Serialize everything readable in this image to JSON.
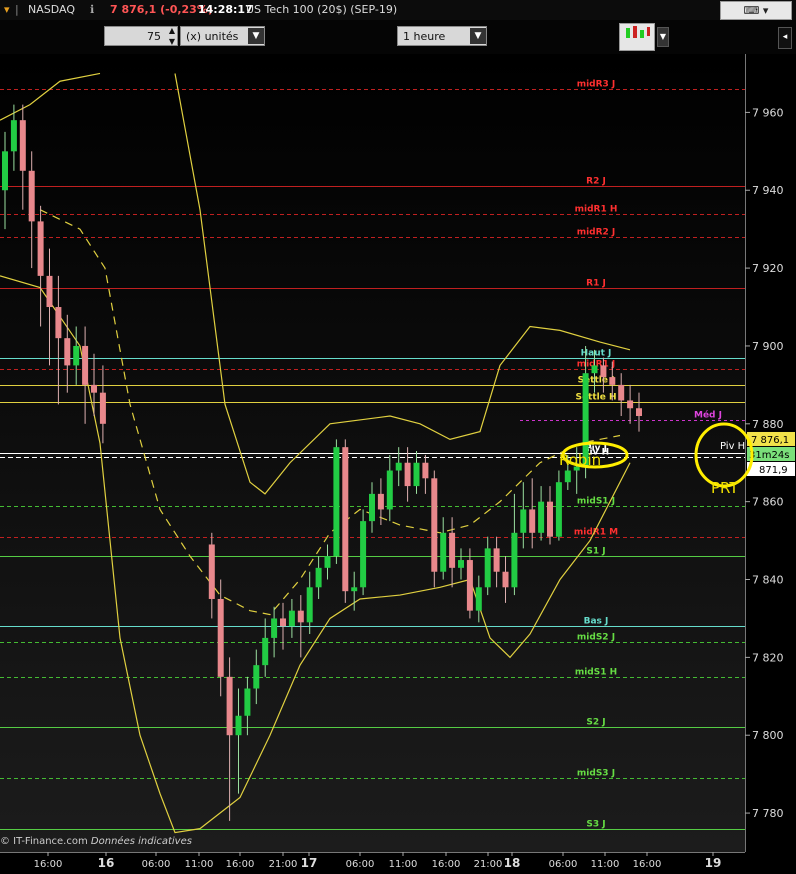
{
  "header": {
    "instrument": "NASDAQ",
    "price_change": "7 876,1 (-0,23%)",
    "time": "14:28:17",
    "description": "US Tech 100 (20$) (SEP-19)"
  },
  "toolbar": {
    "quantity_value": "75",
    "units_label": "(x) unités",
    "timeframe_value": "1 heure"
  },
  "colors": {
    "background": "#000000",
    "bull_candle": "#22cc44",
    "bear_candle": "#e8888c",
    "resistance": "#cc2222",
    "support": "#55cc44",
    "bollinger": "#e0d040",
    "annotation": "#ffee00"
  },
  "annotations": {
    "robin": "Robin",
    "prt": "PRT"
  },
  "footer": {
    "copyright": "© IT-Finance.com",
    "data_note": "Données indicatives"
  },
  "chart_data": {
    "type": "candlestick",
    "ylim": [
      7770,
      7975
    ],
    "y_ticks": [
      "7 960",
      "7 940",
      "7 920",
      "7 900",
      "7 880",
      "7 860",
      "7 840",
      "7 820",
      "7 800",
      "7 780"
    ],
    "x_ticks": [
      "16:00",
      "16",
      "06:00",
      "11:00",
      "16:00",
      "21:00",
      "17",
      "06:00",
      "11:00",
      "16:00",
      "21:00",
      "18",
      "06:00",
      "11:00",
      "16:00",
      "19"
    ],
    "levels": [
      {
        "name": "midR3J",
        "label": "midR3 J",
        "value": 7966,
        "kind": "dashed-red"
      },
      {
        "name": "R2J",
        "label": "R2 J",
        "value": 7941,
        "kind": "solid-red"
      },
      {
        "name": "midR1H",
        "label": "midR1 H",
        "value": 7934,
        "kind": "dashed-red"
      },
      {
        "name": "midR2J",
        "label": "midR2 J",
        "value": 7928,
        "kind": "dashed-red"
      },
      {
        "name": "R1J",
        "label": "R1 J",
        "value": 7915,
        "kind": "solid-red"
      },
      {
        "name": "HautJ",
        "label": "Haut J",
        "value": 7897,
        "kind": "solid-cyan"
      },
      {
        "name": "midR1J",
        "label": "midR1 J",
        "value": 7894,
        "kind": "dashed-red"
      },
      {
        "name": "SettleJ",
        "label": "Settle J",
        "value": 7890,
        "kind": "solid-yellow"
      },
      {
        "name": "SettleH",
        "label": "Settle H",
        "value": 7885.5,
        "kind": "solid-yellow"
      },
      {
        "name": "MedJ",
        "label": "Méd J",
        "value": 7881,
        "kind": "dashed-magenta"
      },
      {
        "name": "PivJ",
        "label": "Piv J",
        "value": 7872.5,
        "kind": "solid-white"
      },
      {
        "name": "PivH",
        "label": "Piv H",
        "value": 7871.5,
        "kind": "dashed-white"
      },
      {
        "name": "midS1J",
        "label": "midS1 J",
        "value": 7859,
        "kind": "dashed-green"
      },
      {
        "name": "midR1M",
        "label": "midR1 M",
        "value": 7851,
        "kind": "dashed-red"
      },
      {
        "name": "S1J",
        "label": "S1 J",
        "value": 7846,
        "kind": "solid-green"
      },
      {
        "name": "BasJ",
        "label": "Bas J",
        "value": 7828,
        "kind": "solid-cyan"
      },
      {
        "name": "midS2J",
        "label": "midS2 J",
        "value": 7824,
        "kind": "dashed-green"
      },
      {
        "name": "midS1H",
        "label": "midS1 H",
        "value": 7815,
        "kind": "dashed-green"
      },
      {
        "name": "S2J",
        "label": "S2 J",
        "value": 7802,
        "kind": "solid-green"
      },
      {
        "name": "midS3J",
        "label": "midS3 J",
        "value": 7789,
        "kind": "dashed-green"
      },
      {
        "name": "S3J",
        "label": "S3 J",
        "value": 7776,
        "kind": "solid-green"
      }
    ],
    "price_labels": {
      "last": "7 876,1",
      "timer": "31m24s",
      "close": "871,9",
      "piv_h": "Piv H"
    },
    "candles": [
      [
        7940,
        7950,
        7930,
        7955
      ],
      [
        7950,
        7958,
        7945,
        7962
      ],
      [
        7958,
        7945,
        7935,
        7962
      ],
      [
        7945,
        7932,
        7920,
        7950
      ],
      [
        7932,
        7918,
        7905,
        7936
      ],
      [
        7918,
        7910,
        7895,
        7925
      ],
      [
        7910,
        7902,
        7885,
        7918
      ],
      [
        7902,
        7895,
        7888,
        7908
      ],
      [
        7895,
        7900,
        7890,
        7905
      ],
      [
        7900,
        7890,
        7880,
        7905
      ],
      [
        7890,
        7888,
        7882,
        7898
      ],
      [
        7888,
        7880,
        7875,
        7895
      ],
      [
        7849,
        7835,
        7830,
        7852
      ],
      [
        7835,
        7815,
        7810,
        7840
      ],
      [
        7815,
        7800,
        7778,
        7820
      ],
      [
        7800,
        7805,
        7785,
        7812
      ],
      [
        7805,
        7812,
        7800,
        7815
      ],
      [
        7812,
        7818,
        7808,
        7822
      ],
      [
        7818,
        7825,
        7815,
        7830
      ],
      [
        7825,
        7830,
        7820,
        7833
      ],
      [
        7830,
        7828,
        7822,
        7834
      ],
      [
        7828,
        7832,
        7825,
        7835
      ],
      [
        7832,
        7829,
        7820,
        7836
      ],
      [
        7829,
        7838,
        7826,
        7842
      ],
      [
        7838,
        7843,
        7835,
        7846
      ],
      [
        7843,
        7846,
        7840,
        7849
      ],
      [
        7846,
        7874,
        7844,
        7876
      ],
      [
        7874,
        7837,
        7834,
        7876
      ],
      [
        7837,
        7838,
        7832,
        7842
      ],
      [
        7838,
        7855,
        7836,
        7858
      ],
      [
        7855,
        7862,
        7852,
        7865
      ],
      [
        7862,
        7858,
        7854,
        7866
      ],
      [
        7858,
        7868,
        7855,
        7872
      ],
      [
        7868,
        7870,
        7864,
        7874
      ],
      [
        7870,
        7864,
        7860,
        7874
      ],
      [
        7864,
        7870,
        7862,
        7873
      ],
      [
        7870,
        7866,
        7862,
        7872
      ],
      [
        7866,
        7842,
        7838,
        7868
      ],
      [
        7842,
        7852,
        7840,
        7856
      ],
      [
        7852,
        7843,
        7838,
        7856
      ],
      [
        7843,
        7845,
        7840,
        7848
      ],
      [
        7845,
        7832,
        7830,
        7848
      ],
      [
        7832,
        7838,
        7829,
        7841
      ],
      [
        7838,
        7848,
        7836,
        7851
      ],
      [
        7848,
        7842,
        7838,
        7851
      ],
      [
        7842,
        7838,
        7834,
        7846
      ],
      [
        7838,
        7852,
        7836,
        7862
      ],
      [
        7852,
        7858,
        7848,
        7865
      ],
      [
        7858,
        7852,
        7848,
        7866
      ],
      [
        7852,
        7860,
        7850,
        7864
      ],
      [
        7860,
        7851,
        7849,
        7864
      ],
      [
        7851,
        7865,
        7850,
        7868
      ],
      [
        7865,
        7868,
        7863,
        7872
      ],
      [
        7868,
        7869,
        7862,
        7874
      ],
      [
        7869,
        7893,
        7866,
        7900
      ],
      [
        7893,
        7895,
        7888,
        7899
      ],
      [
        7895,
        7892,
        7888,
        7897
      ],
      [
        7892,
        7890,
        7886,
        7896
      ],
      [
        7890,
        7886,
        7882,
        7893
      ],
      [
        7886,
        7884,
        7880,
        7890
      ],
      [
        7884,
        7882,
        7878,
        7888
      ],
      [
        7882,
        7878,
        7874,
        7886
      ],
      [
        7878,
        7881,
        7876,
        7884
      ],
      [
        7881,
        7878,
        7874,
        7884
      ],
      [
        7878,
        7883,
        7876,
        7885
      ],
      [
        7883,
        7879,
        7876,
        7886
      ],
      [
        7879,
        7883,
        7876,
        7886
      ],
      [
        7883,
        7881,
        7876,
        7885
      ],
      [
        7881,
        7874,
        7870,
        7885
      ],
      [
        7874,
        7876,
        7872,
        7878
      ]
    ]
  }
}
